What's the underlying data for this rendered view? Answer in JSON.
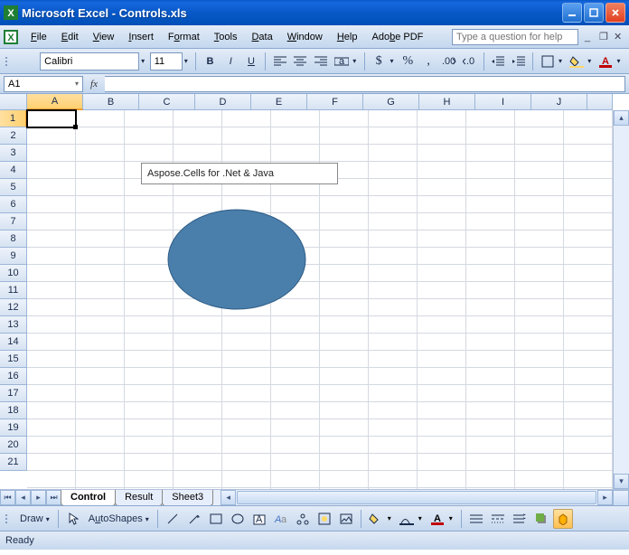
{
  "title": "Microsoft Excel - Controls.xls",
  "menus": {
    "file": "File",
    "edit": "Edit",
    "view": "View",
    "insert": "Insert",
    "format": "Format",
    "tools": "Tools",
    "data": "Data",
    "window": "Window",
    "help": "Help",
    "adobepdf": "Adobe PDF"
  },
  "helpbox_placeholder": "Type a question for help",
  "toolbar": {
    "font": "Calibri",
    "size": "11",
    "currency": "$",
    "percent": "%",
    "comma": ","
  },
  "namebox": "A1",
  "formula": "",
  "columns": [
    "A",
    "B",
    "C",
    "D",
    "E",
    "F",
    "G",
    "H",
    "I",
    "J"
  ],
  "rows": [
    "1",
    "2",
    "3",
    "4",
    "5",
    "6",
    "7",
    "8",
    "9",
    "10",
    "11",
    "12",
    "13",
    "14",
    "15",
    "16",
    "17",
    "18",
    "19",
    "20",
    "21"
  ],
  "textbox_content": "Aspose.Cells for .Net  & Java",
  "oval": {
    "fill": "#4a7eab",
    "stroke": "#2e5c85"
  },
  "sheets": {
    "active": "Control",
    "tab2": "Result",
    "tab3": "Sheet3"
  },
  "drawbar": {
    "draw": "Draw",
    "autoshapes": "AutoShapes"
  },
  "status": "Ready"
}
